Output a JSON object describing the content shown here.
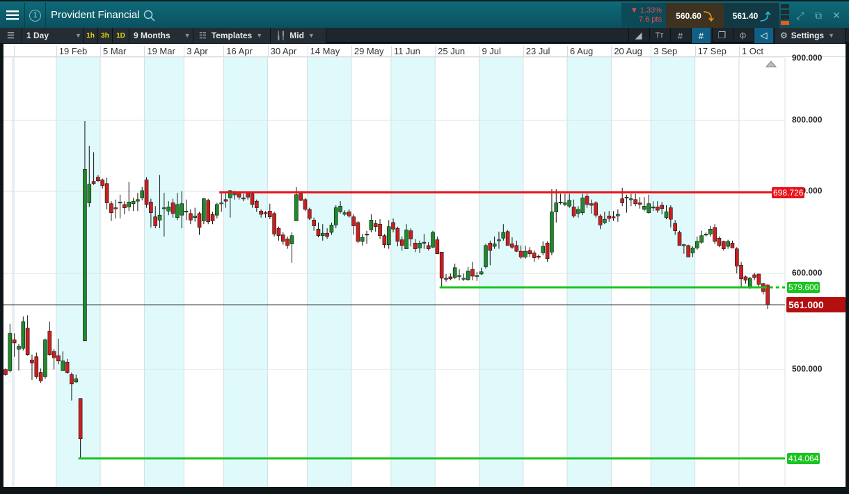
{
  "header": {
    "menu_icon": "hamburger-icon",
    "workspace_number": "1",
    "title": "Provident Financial",
    "search_icon": "search-icon",
    "change_percent": "▼ 1.33%",
    "change_points": "7.6 pts",
    "sell_price": "560.60",
    "buy_price": "561.40",
    "icons": [
      "expand-icon",
      "popout-icon",
      "close-icon"
    ]
  },
  "toolbar": {
    "interval": "1 Day",
    "quick_1h": "1h",
    "quick_3h": "3h",
    "quick_1d": "1D",
    "range": "9 Months",
    "templates": "Templates",
    "price_type": "Mid",
    "settings": "Settings",
    "dropdown_arrow": "▼"
  },
  "colors": {
    "up": "#1f8a2a",
    "down": "#cc1f1f",
    "resistance": "#e8141a",
    "support": "#19c41f",
    "current": "#b30f0f",
    "band": "#e0fafc"
  },
  "chart_data": {
    "type": "candlestick",
    "title": "Provident Financial",
    "price_scale": "log",
    "y_ticks": [
      {
        "value": 900,
        "label": "900.000"
      },
      {
        "value": 800,
        "label": "800.000"
      },
      {
        "value": 700,
        "label": "700.000"
      },
      {
        "value": 600,
        "label": "600.000"
      },
      {
        "value": 500,
        "label": "500.000"
      }
    ],
    "x_band_boundaries": [
      2,
      12,
      22,
      32,
      41,
      50,
      60,
      69,
      79,
      88,
      98,
      108,
      118,
      128,
      138,
      147,
      157,
      167
    ],
    "x_ticks": [
      {
        "index": 12,
        "label": "19 Feb"
      },
      {
        "index": 22,
        "label": "5 Mar"
      },
      {
        "index": 32,
        "label": "19 Mar"
      },
      {
        "index": 41,
        "label": "3 Apr"
      },
      {
        "index": 50,
        "label": "16 Apr"
      },
      {
        "index": 60,
        "label": "30 Apr"
      },
      {
        "index": 69,
        "label": "14 May"
      },
      {
        "index": 79,
        "label": "29 May"
      },
      {
        "index": 88,
        "label": "11 Jun"
      },
      {
        "index": 98,
        "label": "25 Jun"
      },
      {
        "index": 108,
        "label": "9 Jul"
      },
      {
        "index": 118,
        "label": "23 Jul"
      },
      {
        "index": 128,
        "label": "6 Aug"
      },
      {
        "index": 138,
        "label": "20 Aug"
      },
      {
        "index": 147,
        "label": "3 Sep"
      },
      {
        "index": 157,
        "label": "17 Sep"
      },
      {
        "index": 167,
        "label": "1 Oct"
      }
    ],
    "levels": [
      {
        "name": "resistance",
        "value": 698.726,
        "label": "698.726",
        "from_index": 49,
        "color": "#e8141a"
      },
      {
        "name": "support-recent",
        "value": 579.6,
        "label": "579.600",
        "from_index": 99,
        "color": "#19c41f",
        "dashed_from_index": 172
      },
      {
        "name": "support-low",
        "value": 414.064,
        "label": "414.064",
        "from_index": 17,
        "color": "#19c41f"
      }
    ],
    "current_price": {
      "value": 561.0,
      "label": "561.000"
    },
    "ohlc": [
      [
        500,
        501,
        494,
        495
      ],
      [
        499,
        543,
        497,
        534
      ],
      [
        528,
        534,
        512,
        525
      ],
      [
        519,
        524,
        499,
        522
      ],
      [
        520,
        550,
        518,
        545
      ],
      [
        539,
        551,
        513,
        514
      ],
      [
        509,
        514,
        490,
        506
      ],
      [
        512,
        516,
        491,
        493
      ],
      [
        497,
        501,
        487,
        489
      ],
      [
        493,
        529,
        491,
        528
      ],
      [
        536,
        545,
        513,
        514
      ],
      [
        517,
        519,
        500,
        511
      ],
      [
        513,
        529,
        505,
        508
      ],
      [
        499,
        517,
        499,
        508
      ],
      [
        507,
        510,
        496,
        497
      ],
      [
        495,
        497,
        470,
        486
      ],
      [
        488,
        495,
        487,
        491
      ],
      [
        472,
        472,
        414,
        433
      ],
      [
        527,
        799,
        527,
        731
      ],
      [
        686,
        764,
        681,
        710
      ],
      [
        714,
        755,
        709,
        711
      ],
      [
        720,
        723,
        713,
        715
      ],
      [
        716,
        718,
        704,
        708
      ],
      [
        711,
        719,
        678,
        686
      ],
      [
        685,
        688,
        664,
        674
      ],
      [
        680,
        690,
        667,
        679
      ],
      [
        686,
        696,
        667,
        687
      ],
      [
        684,
        688,
        672,
        680
      ],
      [
        681,
        713,
        676,
        687
      ],
      [
        685,
        692,
        676,
        688
      ],
      [
        688,
        698,
        676,
        690
      ],
      [
        692,
        706,
        689,
        701
      ],
      [
        716,
        720,
        680,
        684
      ],
      [
        687,
        691,
        656,
        674
      ],
      [
        669,
        682,
        655,
        658
      ],
      [
        665,
        723,
        655,
        671
      ],
      [
        679,
        698,
        645,
        680
      ],
      [
        676,
        688,
        671,
        681
      ],
      [
        686,
        691,
        668,
        673
      ],
      [
        668,
        698,
        665,
        684
      ],
      [
        671,
        700,
        655,
        685
      ],
      [
        676,
        690,
        665,
        676
      ],
      [
        673,
        678,
        660,
        665
      ],
      [
        668,
        680,
        663,
        670
      ],
      [
        673,
        675,
        647,
        656
      ],
      [
        664,
        692,
        660,
        691
      ],
      [
        689,
        691,
        660,
        663
      ],
      [
        672,
        675,
        660,
        664
      ],
      [
        671,
        686,
        667,
        684
      ],
      [
        685,
        698,
        675,
        686
      ],
      [
        690,
        700,
        680,
        688
      ],
      [
        692,
        702,
        668,
        701
      ],
      [
        697,
        701,
        690,
        697
      ],
      [
        698,
        700,
        690,
        693
      ],
      [
        692,
        697,
        688,
        691
      ],
      [
        698,
        700,
        690,
        693
      ],
      [
        697,
        699,
        680,
        684
      ],
      [
        688,
        690,
        675,
        680
      ],
      [
        676,
        678,
        668,
        672
      ],
      [
        674,
        676,
        668,
        673
      ],
      [
        676,
        685,
        666,
        669
      ],
      [
        673,
        675,
        645,
        648
      ],
      [
        655,
        657,
        640,
        646
      ],
      [
        647,
        650,
        635,
        639
      ],
      [
        642,
        645,
        630,
        634
      ],
      [
        636,
        650,
        613,
        646
      ],
      [
        664,
        706,
        664,
        696
      ],
      [
        697,
        700,
        688,
        689
      ],
      [
        690,
        692,
        676,
        678
      ],
      [
        678,
        680,
        665,
        667
      ],
      [
        665,
        668,
        652,
        658
      ],
      [
        654,
        662,
        644,
        646
      ],
      [
        646,
        660,
        640,
        649
      ],
      [
        649,
        655,
        642,
        645
      ],
      [
        650,
        662,
        647,
        659
      ],
      [
        659,
        683,
        655,
        680
      ],
      [
        675,
        688,
        673,
        682
      ],
      [
        672,
        677,
        670,
        674
      ],
      [
        675,
        678,
        668,
        670
      ],
      [
        669,
        672,
        647,
        658
      ],
      [
        662,
        664,
        637,
        639
      ],
      [
        639,
        648,
        634,
        644
      ],
      [
        647,
        652,
        636,
        648
      ],
      [
        653,
        672,
        650,
        665
      ],
      [
        661,
        665,
        651,
        657
      ],
      [
        660,
        666,
        642,
        646
      ],
      [
        646,
        648,
        631,
        635
      ],
      [
        635,
        665,
        630,
        657
      ],
      [
        662,
        667,
        650,
        654
      ],
      [
        655,
        657,
        633,
        639
      ],
      [
        641,
        645,
        628,
        634
      ],
      [
        630,
        660,
        630,
        653
      ],
      [
        652,
        655,
        633,
        642
      ],
      [
        637,
        642,
        626,
        630
      ],
      [
        631,
        640,
        625,
        637
      ],
      [
        637,
        648,
        630,
        638
      ],
      [
        634,
        638,
        628,
        630
      ],
      [
        632,
        652,
        631,
        650
      ],
      [
        641,
        645,
        624,
        624
      ],
      [
        626,
        626,
        580,
        593
      ],
      [
        593,
        599,
        588,
        592
      ],
      [
        595,
        600,
        590,
        592
      ],
      [
        594,
        612,
        592,
        607
      ],
      [
        597,
        605,
        590,
        597
      ],
      [
        593,
        600,
        589,
        593
      ],
      [
        591,
        608,
        589,
        603
      ],
      [
        605,
        614,
        590,
        596
      ],
      [
        597,
        602,
        589,
        597
      ],
      [
        599,
        607,
        598,
        602
      ],
      [
        608,
        636,
        606,
        634
      ],
      [
        637,
        640,
        610,
        628
      ],
      [
        633,
        645,
        630,
        636
      ],
      [
        641,
        651,
        630,
        641
      ],
      [
        643,
        660,
        640,
        650
      ],
      [
        651,
        653,
        634,
        634
      ],
      [
        636,
        644,
        630,
        632
      ],
      [
        634,
        640,
        626,
        627
      ],
      [
        627,
        634,
        618,
        620
      ],
      [
        620,
        634,
        618,
        627
      ],
      [
        628,
        632,
        620,
        624
      ],
      [
        625,
        628,
        614,
        619
      ],
      [
        621,
        623,
        617,
        620
      ],
      [
        625,
        639,
        622,
        633
      ],
      [
        637,
        639,
        614,
        618
      ],
      [
        626,
        703,
        622,
        675
      ],
      [
        675,
        703,
        662,
        686
      ],
      [
        686,
        697,
        684,
        687
      ],
      [
        684,
        697,
        682,
        686
      ],
      [
        682,
        697,
        680,
        689
      ],
      [
        681,
        690,
        668,
        670
      ],
      [
        673,
        682,
        668,
        678
      ],
      [
        674,
        697,
        671,
        692
      ],
      [
        694,
        697,
        680,
        684
      ],
      [
        685,
        690,
        673,
        683
      ],
      [
        686,
        688,
        668,
        671
      ],
      [
        670,
        672,
        654,
        659
      ],
      [
        662,
        675,
        660,
        666
      ],
      [
        670,
        676,
        663,
        667
      ],
      [
        669,
        676,
        664,
        668
      ],
      [
        670,
        678,
        663,
        672
      ],
      [
        691,
        705,
        682,
        686
      ],
      [
        692,
        696,
        674,
        693
      ],
      [
        691,
        697,
        682,
        691
      ],
      [
        690,
        697,
        682,
        685
      ],
      [
        686,
        693,
        679,
        684
      ],
      [
        678,
        693,
        676,
        682
      ],
      [
        674,
        696,
        673,
        685
      ],
      [
        681,
        688,
        676,
        681
      ],
      [
        681,
        688,
        674,
        677
      ],
      [
        683,
        687,
        672,
        679
      ],
      [
        668,
        683,
        666,
        675
      ],
      [
        680,
        683,
        656,
        666
      ],
      [
        661,
        665,
        647,
        652
      ],
      [
        650,
        652,
        634,
        634
      ],
      [
        635,
        636,
        624,
        635
      ],
      [
        634,
        635,
        620,
        620
      ],
      [
        625,
        633,
        620,
        631
      ],
      [
        631,
        645,
        629,
        639
      ],
      [
        638,
        652,
        636,
        646
      ],
      [
        648,
        650,
        645,
        648
      ],
      [
        648,
        658,
        645,
        654
      ],
      [
        656,
        660,
        636,
        639
      ],
      [
        643,
        645,
        632,
        634
      ],
      [
        639,
        640,
        628,
        630
      ],
      [
        633,
        641,
        630,
        639
      ],
      [
        637,
        640,
        631,
        631
      ],
      [
        630,
        632,
        600,
        609
      ],
      [
        610,
        614,
        580,
        592
      ],
      [
        595,
        597,
        585,
        590
      ],
      [
        580,
        595,
        578,
        593
      ],
      [
        598,
        601,
        590,
        594
      ],
      [
        599,
        600,
        580,
        584
      ],
      [
        585,
        586,
        572,
        575
      ],
      [
        583,
        584,
        557,
        561
      ]
    ]
  }
}
